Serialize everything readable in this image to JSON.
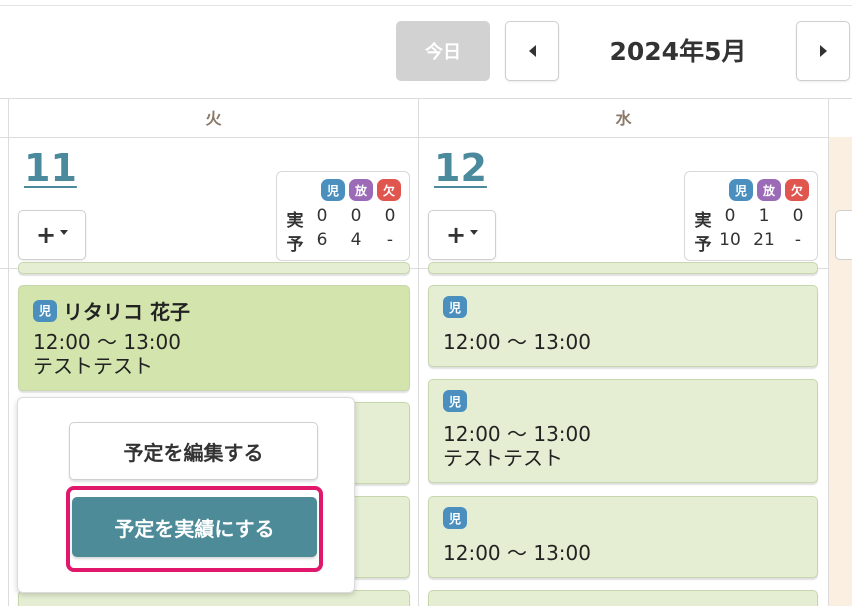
{
  "header": {
    "today_label": "今日",
    "month_title": "2024年5月"
  },
  "weekdays": {
    "tue": "火",
    "wed": "水"
  },
  "days": [
    {
      "number": "11",
      "add_label": "+",
      "stats": {
        "actual_label": "実",
        "planned_label": "予",
        "actual": [
          "0",
          "0",
          "0"
        ],
        "planned": [
          "6",
          "4",
          "-"
        ]
      }
    },
    {
      "number": "12",
      "add_label": "+",
      "stats": {
        "actual_label": "実",
        "planned_label": "予",
        "actual": [
          "0",
          "1",
          "0"
        ],
        "planned": [
          "10",
          "21",
          "-"
        ]
      }
    }
  ],
  "badges": {
    "ji": "児",
    "ho": "放",
    "ke": "欠"
  },
  "colors": {
    "accent": "#4e8b99",
    "highlight": "#e0176b",
    "card_green": "#d3e4ad",
    "card_light": "#e5eed2",
    "badge_ji": "#4b8fbf",
    "badge_ho": "#9b6bb8",
    "badge_ke": "#e0564f"
  },
  "events": {
    "tue": [
      {
        "name": "リタリコ 花子",
        "time": "12:00 ～ 13:00",
        "note": "テストテスト"
      }
    ],
    "wed": [
      {
        "name": "",
        "time": "12:00 ～ 13:00",
        "note": ""
      },
      {
        "name": "",
        "time": "12:00 ～ 13:00",
        "note": "テストテスト"
      },
      {
        "name": "",
        "time": "12:00 ～ 13:00",
        "note": ""
      }
    ]
  },
  "popup": {
    "edit_label": "予定を編集する",
    "commit_label": "予定を実績にする"
  }
}
